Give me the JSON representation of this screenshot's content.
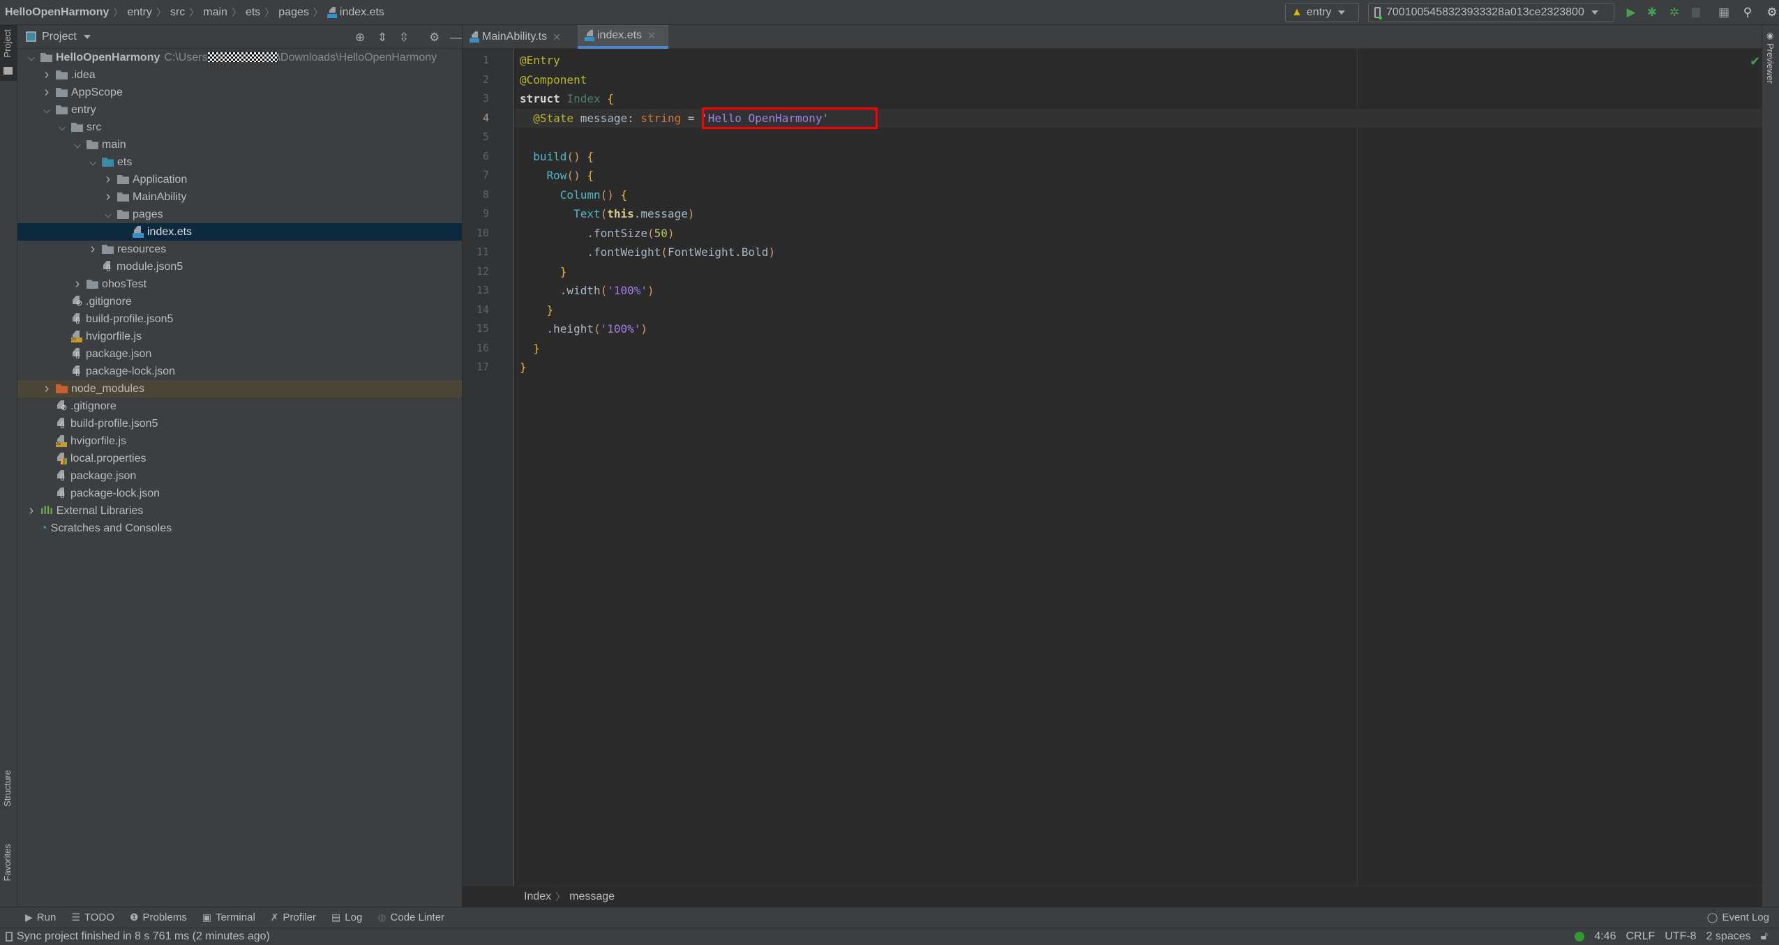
{
  "breadcrumb": [
    "HelloOpenHarmony",
    "entry",
    "src",
    "main",
    "ets",
    "pages",
    "index.ets"
  ],
  "run_config": {
    "module": "entry",
    "device": "7001005458323933328a013ce2323800"
  },
  "toolbar_icons": [
    "run-icon",
    "debug-icon",
    "attach-debugger-icon",
    "stop-icon",
    "project-structure-icon",
    "search-icon",
    "settings-icon"
  ],
  "left_strip": {
    "project": "Project",
    "structure": "Structure",
    "favorites": "Favorites"
  },
  "right_strip": {
    "previewer": "Previewer"
  },
  "project_panel": {
    "title": "Project",
    "tree": [
      {
        "label": "HelloOpenHarmony",
        "path_prefix": "C:\\Users",
        "path_suffix": "\\Downloads\\HelloOpenHarmony",
        "depth": 0,
        "state": "open",
        "icon": "module",
        "bold": true
      },
      {
        "label": ".idea",
        "depth": 1,
        "state": "closed",
        "icon": "folder"
      },
      {
        "label": "AppScope",
        "depth": 1,
        "state": "closed",
        "icon": "folder"
      },
      {
        "label": "entry",
        "depth": 1,
        "state": "open",
        "icon": "module"
      },
      {
        "label": "src",
        "depth": 2,
        "state": "open",
        "icon": "folder"
      },
      {
        "label": "main",
        "depth": 3,
        "state": "open",
        "icon": "folder"
      },
      {
        "label": "ets",
        "depth": 4,
        "state": "open",
        "icon": "folder-blue"
      },
      {
        "label": "Application",
        "depth": 5,
        "state": "closed",
        "icon": "folder"
      },
      {
        "label": "MainAbility",
        "depth": 5,
        "state": "closed",
        "icon": "folder"
      },
      {
        "label": "pages",
        "depth": 5,
        "state": "open",
        "icon": "folder"
      },
      {
        "label": "index.ets",
        "depth": 6,
        "state": "leaf",
        "icon": "ets",
        "selected": true
      },
      {
        "label": "resources",
        "depth": 4,
        "state": "closed",
        "icon": "folder"
      },
      {
        "label": "module.json5",
        "depth": 4,
        "state": "leaf",
        "icon": "json"
      },
      {
        "label": "ohosTest",
        "depth": 3,
        "state": "closed",
        "icon": "folder"
      },
      {
        "label": ".gitignore",
        "depth": 2,
        "state": "leaf",
        "icon": "git"
      },
      {
        "label": "build-profile.json5",
        "depth": 2,
        "state": "leaf",
        "icon": "json"
      },
      {
        "label": "hvigorfile.js",
        "depth": 2,
        "state": "leaf",
        "icon": "js"
      },
      {
        "label": "package.json",
        "depth": 2,
        "state": "leaf",
        "icon": "json"
      },
      {
        "label": "package-lock.json",
        "depth": 2,
        "state": "leaf",
        "icon": "json"
      },
      {
        "label": "node_modules",
        "depth": 1,
        "state": "closed",
        "icon": "folder-orange",
        "highlight": true
      },
      {
        "label": ".gitignore",
        "depth": 1,
        "state": "leaf",
        "icon": "git"
      },
      {
        "label": "build-profile.json5",
        "depth": 1,
        "state": "leaf",
        "icon": "json"
      },
      {
        "label": "hvigorfile.js",
        "depth": 1,
        "state": "leaf",
        "icon": "js"
      },
      {
        "label": "local.properties",
        "depth": 1,
        "state": "leaf",
        "icon": "prop"
      },
      {
        "label": "package.json",
        "depth": 1,
        "state": "leaf",
        "icon": "json"
      },
      {
        "label": "package-lock.json",
        "depth": 1,
        "state": "leaf",
        "icon": "json"
      },
      {
        "label": "External Libraries",
        "depth": 0,
        "state": "closed",
        "icon": "libraries"
      },
      {
        "label": "Scratches and Consoles",
        "depth": 0,
        "state": "leaf",
        "icon": "scratches"
      }
    ]
  },
  "editor": {
    "tabs": [
      {
        "label": "MainAbility.ts",
        "icon": "ts",
        "active": false
      },
      {
        "label": "index.ets",
        "icon": "ets",
        "active": true
      }
    ],
    "current_line": 4,
    "lines": [
      [
        [
          "@Entry",
          "ann"
        ]
      ],
      [
        [
          "@Component",
          "ann"
        ]
      ],
      [
        [
          "struct ",
          "struct"
        ],
        [
          "Index ",
          "cls"
        ],
        [
          "{",
          "br"
        ]
      ],
      [
        [
          "  "
        ],
        [
          "@State ",
          "ann"
        ],
        [
          "message",
          "id"
        ],
        [
          ": ",
          "id"
        ],
        [
          "string ",
          "kw"
        ],
        [
          "= ",
          "id"
        ],
        [
          "'Hello OpenHarmony'",
          "str"
        ]
      ],
      [],
      [
        [
          "  "
        ],
        [
          "build",
          "fn"
        ],
        [
          "() ",
          "par"
        ],
        [
          "{",
          "br"
        ]
      ],
      [
        [
          "    "
        ],
        [
          "Row",
          "fn"
        ],
        [
          "() ",
          "par"
        ],
        [
          "{",
          "br"
        ]
      ],
      [
        [
          "      "
        ],
        [
          "Column",
          "fn"
        ],
        [
          "() ",
          "par"
        ],
        [
          "{",
          "br"
        ]
      ],
      [
        [
          "        "
        ],
        [
          "Text",
          "fn"
        ],
        [
          "(",
          "par"
        ],
        [
          "this",
          "this"
        ],
        [
          ".message",
          "id"
        ],
        [
          ")",
          "par"
        ]
      ],
      [
        [
          "          "
        ],
        [
          ".fontSize",
          "id"
        ],
        [
          "(",
          "par"
        ],
        [
          "50",
          "num"
        ],
        [
          ")",
          "par"
        ]
      ],
      [
        [
          "          "
        ],
        [
          ".fontWeight",
          "id"
        ],
        [
          "(",
          "par"
        ],
        [
          "FontWeight.Bold",
          "id"
        ],
        [
          ")",
          "par"
        ]
      ],
      [
        [
          "      "
        ],
        [
          "}",
          "br"
        ]
      ],
      [
        [
          "      "
        ],
        [
          ".width",
          "id"
        ],
        [
          "(",
          "par"
        ],
        [
          "'100%'",
          "str"
        ],
        [
          ")",
          "par"
        ]
      ],
      [
        [
          "    "
        ],
        [
          "}",
          "br"
        ]
      ],
      [
        [
          "    "
        ],
        [
          ".height",
          "id"
        ],
        [
          "(",
          "par"
        ],
        [
          "'100%'",
          "str"
        ],
        [
          ")",
          "par"
        ]
      ],
      [
        [
          "  "
        ],
        [
          "}",
          "br"
        ]
      ],
      [
        [
          "}",
          "br"
        ]
      ]
    ],
    "breadcrumb": [
      "Index",
      "message"
    ]
  },
  "tool_windows": [
    "Run",
    "TODO",
    "Problems",
    "Terminal",
    "Profiler",
    "Log",
    "Code Linter"
  ],
  "event_log": "Event Log",
  "status": {
    "message": "Sync project finished in 8 s 761 ms (2 minutes ago)",
    "position": "4:46",
    "line_sep": "CRLF",
    "encoding": "UTF-8",
    "indent": "2 spaces"
  },
  "colors": {
    "accent": "#4a88c7",
    "selected_row": "#0d293e",
    "highlight": "#ff0000",
    "ok": "#499c54"
  }
}
